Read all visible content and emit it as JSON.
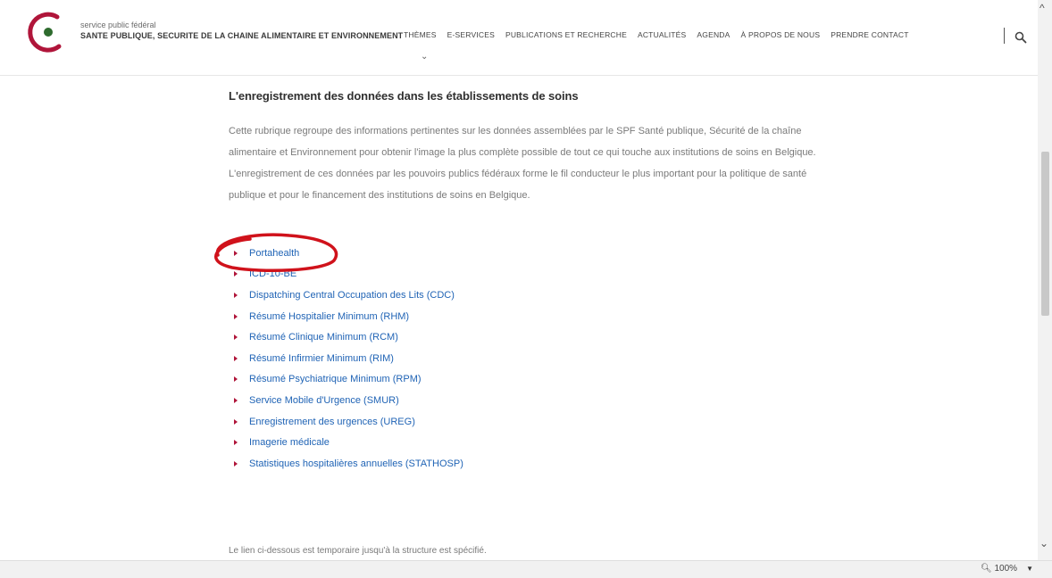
{
  "header": {
    "brand_small": "service public fédéral",
    "brand_big": "SANTE PUBLIQUE, SECURITE DE LA CHAINE ALIMENTAIRE ET ENVIRONNEMENT",
    "nav": [
      "THÈMES",
      "E-SERVICES",
      "PUBLICATIONS ET RECHERCHE",
      "ACTUALITÉS",
      "AGENDA",
      "À PROPOS DE NOUS",
      "PRENDRE CONTACT"
    ],
    "search_icon": "search-icon"
  },
  "main": {
    "heading": "L'enregistrement des données dans les établissements de soins",
    "intro": "Cette rubrique regroupe des informations pertinentes sur les données assemblées par le SPF Santé publique, Sécurité de la chaîne alimentaire et Environnement pour obtenir l'image la plus complète possible de tout ce qui touche aux institutions de soins en Belgique. L'enregistrement de ces données par les pouvoirs publics fédéraux forme le fil conducteur le plus important pour la politique de santé publique et pour le financement des institutions de soins en Belgique.",
    "links": [
      "Portahealth",
      "ICD-10-BE",
      "Dispatching Central Occupation des Lits (CDC)",
      "Résumé Hospitalier Minimum (RHM)",
      "Résumé Clinique Minimum (RCM)",
      "Résumé Infirmier Minimum (RIM)",
      "Résumé Psychiatrique Minimum (RPM)",
      "Service Mobile d'Urgence (SMUR)",
      "Enregistrement des urgences (UREG)",
      "Imagerie médicale",
      "Statistiques hospitalières annuelles (STATHOSP)"
    ],
    "footnote": "Le lien ci-dessous est temporaire jusqu'à la structure est spécifié."
  },
  "status": {
    "zoom": "100%"
  },
  "colors": {
    "link": "#1f63b5",
    "bullet": "#b0153a",
    "annotation": "#d0121b",
    "logo_red": "#b0153a",
    "logo_green": "#2e6b2e"
  }
}
